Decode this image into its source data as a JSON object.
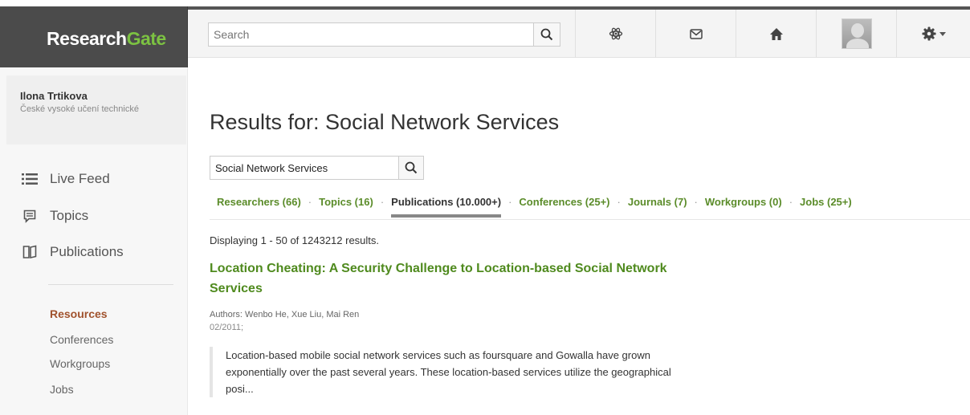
{
  "brand": {
    "part1": "Research",
    "part2": "Gate"
  },
  "header": {
    "search_placeholder": "Search",
    "icons": [
      "search-icon",
      "atom-icon",
      "mail-icon",
      "home-icon",
      "avatar",
      "gear-icon"
    ]
  },
  "user": {
    "name": "Ilona Trtikova",
    "institution": "České vysoké učení technické"
  },
  "nav": [
    {
      "label": "Live Feed",
      "icon": "list-icon"
    },
    {
      "label": "Topics",
      "icon": "comment-icon"
    },
    {
      "label": "Publications",
      "icon": "book-icon"
    }
  ],
  "resources": {
    "title": "Resources",
    "items": [
      "Conferences",
      "Workgroups",
      "Jobs"
    ]
  },
  "results": {
    "heading": "Results for: Social Network Services",
    "query": "Social Network Services",
    "tabs": [
      {
        "label": "Researchers (66)",
        "active": false
      },
      {
        "label": "Topics (16)",
        "active": false
      },
      {
        "label": "Publications (10.000+)",
        "active": true
      },
      {
        "label": "Conferences (25+)",
        "active": false
      },
      {
        "label": "Journals (7)",
        "active": false
      },
      {
        "label": "Workgroups (0)",
        "active": false
      },
      {
        "label": "Jobs (25+)",
        "active": false
      }
    ],
    "displaying": "Displaying 1 - 50 of 1243212 results."
  },
  "publication": {
    "title": "Location Cheating: A Security Challenge to Location-based Social Network Services",
    "authors": "Authors: Wenbo He, Xue Liu, Mai Ren",
    "date": "02/2011;",
    "abstract": "Location-based mobile social network services such as foursquare and Gowalla have grown exponentially over the past several years. These location-based services utilize the geographical posi..."
  },
  "colors": {
    "accent_green": "#5b8c2a",
    "title_green": "#4f8a1e",
    "resources_brown": "#a0522d",
    "logo_green": "#7cc242"
  }
}
